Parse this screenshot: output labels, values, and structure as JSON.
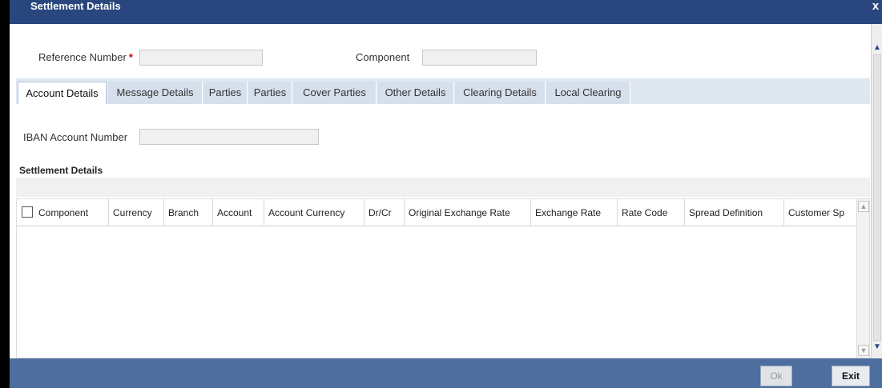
{
  "window": {
    "title": "Settlement Details",
    "close_symbol": "x"
  },
  "form": {
    "reference_number": {
      "label": "Reference Number",
      "required_mark": "*",
      "value": ""
    },
    "component": {
      "label": "Component",
      "value": ""
    },
    "iban_account_number": {
      "label": "IBAN Account Number",
      "value": ""
    }
  },
  "tabs": [
    {
      "label": "Account Details",
      "active": true
    },
    {
      "label": "Message Details",
      "active": false
    },
    {
      "label": "Parties",
      "active": false
    },
    {
      "label": "Parties",
      "active": false
    },
    {
      "label": "Cover Parties",
      "active": false
    },
    {
      "label": "Other Details",
      "active": false
    },
    {
      "label": "Clearing Details",
      "active": false
    },
    {
      "label": "Local Clearing",
      "active": false
    }
  ],
  "settlement": {
    "section_title": "Settlement Details",
    "columns": [
      "Component",
      "Currency",
      "Branch",
      "Account",
      "Account Currency",
      "Dr/Cr",
      "Original Exchange Rate",
      "Exchange Rate",
      "Rate Code",
      "Spread Definition",
      "Customer Sp"
    ]
  },
  "footer": {
    "ok_label": "Ok",
    "exit_label": "Exit"
  }
}
